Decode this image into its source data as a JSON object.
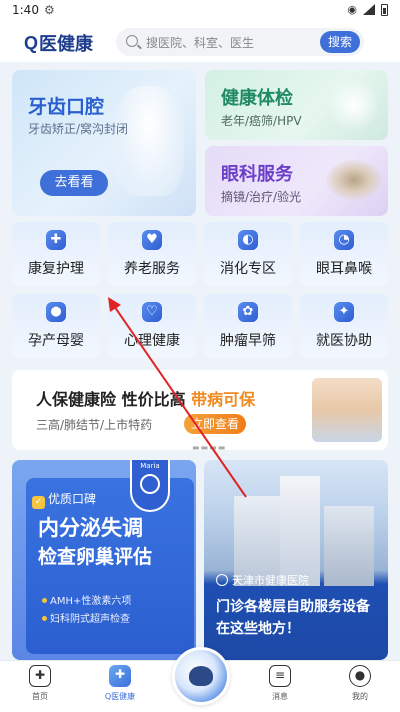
{
  "status_bar": {
    "time": "1:40"
  },
  "header": {
    "logo_q": "Q",
    "logo_text": "医健康",
    "search_placeholder": "搜医院、科室、医生",
    "search_button": "搜索"
  },
  "top_cards": {
    "dental": {
      "title": "牙齿口腔",
      "subtitle": "牙齿矫正/窝沟封闭",
      "button": "去看看"
    },
    "checkup": {
      "title": "健康体检",
      "subtitle": "老年/癌筛/HPV"
    },
    "eye": {
      "title": "眼科服务",
      "subtitle": "摘镜/治疗/验光"
    }
  },
  "services": [
    {
      "label": "康复护理",
      "icon": "rehab-icon"
    },
    {
      "label": "养老服务",
      "icon": "elderly-care-icon"
    },
    {
      "label": "消化专区",
      "icon": "stomach-icon"
    },
    {
      "label": "眼耳鼻喉",
      "icon": "ear-icon"
    },
    {
      "label": "孕产母婴",
      "icon": "pregnancy-icon"
    },
    {
      "label": "心理健康",
      "icon": "mental-health-icon"
    },
    {
      "label": "肿瘤早筛",
      "icon": "cell-icon"
    },
    {
      "label": "就医协助",
      "icon": "handshake-icon"
    }
  ],
  "insurance": {
    "title_a": "人保健康险 性价比高 ",
    "title_b": "带病可保",
    "subtitle": "三高/肺结节/上市特药",
    "button": "立即查看"
  },
  "promo_left": {
    "badge": "Maria",
    "tag": "优质口碑",
    "headline_1": "内分泌失调",
    "headline_2": "检查卵巢评估",
    "bullet_1": "AMH+性激素六项",
    "bullet_2": "妇科阴式超声检查"
  },
  "promo_right": {
    "hospital": "天津市健康医院",
    "headline_1": "门诊各楼层自助服务设备",
    "headline_2": "在这些地方！"
  },
  "bottom_nav": [
    {
      "label": "首页",
      "icon": "home-plus-icon",
      "active": false
    },
    {
      "label": "Q医健康",
      "icon": "medical-kit-icon",
      "active": true
    },
    {
      "label": "消息",
      "icon": "message-icon",
      "active": false
    },
    {
      "label": "我的",
      "icon": "user-icon",
      "active": false
    }
  ],
  "colors": {
    "primary": "#3f6fd9",
    "accent_orange": "#f08a1f",
    "dental_title": "#2a5fcf",
    "checkup_title": "#1f8a63",
    "eye_title": "#6d3fc9",
    "annotation_arrow": "#e02424"
  }
}
